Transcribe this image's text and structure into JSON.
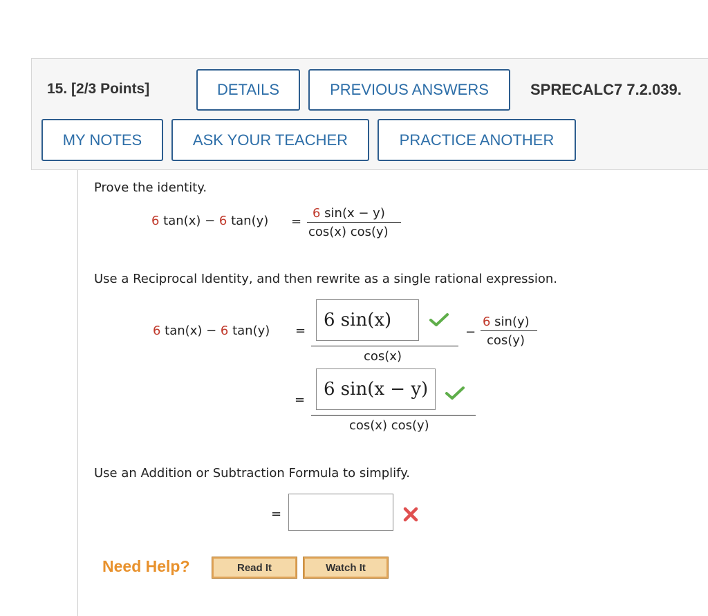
{
  "header": {
    "question_number": "15.",
    "points": "[2/3 Points]",
    "details_button": "DETAILS",
    "previous_answers_button": "PREVIOUS ANSWERS",
    "problem_code": "SPRECALC7 7.2.039.",
    "my_notes_button": "MY NOTES",
    "ask_teacher_button": "ASK YOUR TEACHER",
    "practice_another_button": "PRACTICE ANOTHER"
  },
  "problem": {
    "instruction": "Prove the identity.",
    "identity_lhs_coef1": "6",
    "identity_lhs_mid": " tan(x) − ",
    "identity_lhs_coef2": "6",
    "identity_lhs_end": " tan(y)",
    "equals": "=",
    "identity_rhs_num_coef": "6",
    "identity_rhs_num": " sin(x − y)",
    "identity_rhs_den": "cos(x) cos(y)"
  },
  "step1": {
    "instruction": "Use a Reciprocal Identity, and then rewrite as a single rational expression.",
    "lhs_coef1": "6",
    "lhs_mid": " tan(x) − ",
    "lhs_coef2": "6",
    "lhs_end": " tan(y)",
    "equals": "=",
    "answer1": "6 sin(x)",
    "den1": "cos(x)",
    "minus": "−",
    "term2_num_coef": "6",
    "term2_num": " sin(y)",
    "term2_den": "cos(y)",
    "equals2": "=",
    "answer2": "6 sin(x − y)",
    "den2": "cos(x) cos(y)"
  },
  "step2": {
    "instruction": "Use an Addition or Subtraction Formula to simplify.",
    "equals": "=",
    "answer3": ""
  },
  "help": {
    "label": "Need Help?",
    "read_it": "Read It",
    "watch_it": "Watch It"
  },
  "colors": {
    "button_border": "#2d5d8e",
    "button_text": "#2d6ea8",
    "correct_check": "#5fae4a",
    "incorrect_cross": "#e05050",
    "red_coefficient": "#c0392b"
  }
}
